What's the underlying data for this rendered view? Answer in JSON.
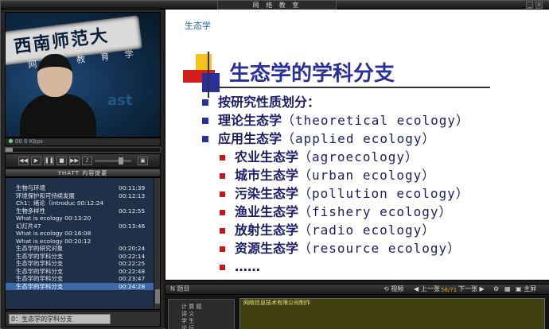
{
  "app": {
    "window_title": "网 络 教 室"
  },
  "video": {
    "banner_text": "西南师范大",
    "banner_sub": "网 络 教 育 学",
    "wall_text": "ast",
    "status": "00  0  Kbps"
  },
  "playlist": {
    "header": "YHATT  内容提要",
    "items": [
      {
        "label": "生物与环境",
        "time": "00:11:39"
      },
      {
        "label": "环境保护和可持续发展",
        "time": "00:12:13"
      },
      {
        "label": "Ch1：绪论（introduc 00:12:24",
        "time": ""
      },
      {
        "label": "生物多样性",
        "time": "00:12:55"
      },
      {
        "label": "What is ecology 00:13:20",
        "time": ""
      },
      {
        "label": "幻灯片47",
        "time": "00:13:46"
      },
      {
        "label": "What is ecology 00:16:08",
        "time": ""
      },
      {
        "label": "What is ecology 00:20:12",
        "time": ""
      },
      {
        "label": "生态学的研究对象",
        "time": "00:20:24"
      },
      {
        "label": "生态学的学科分支",
        "time": "00:22:14"
      },
      {
        "label": "生态学的学科分支",
        "time": "00:22:25"
      },
      {
        "label": "生态学的学科分支",
        "time": "00:22:48"
      },
      {
        "label": "生态学的学科分支",
        "time": "00:23:47"
      },
      {
        "label": "生态学的学科分支",
        "time": "00:24:28"
      }
    ],
    "status_field": "0：生态学的学科分支"
  },
  "slide": {
    "corner_label": "生态学",
    "title": "生态学的学科分支",
    "level1": [
      {
        "cn": "按研究性质划分：",
        "en": ""
      },
      {
        "cn": "理论生态学",
        "en": "（theoretical ecology）"
      },
      {
        "cn": "应用生态学",
        "en": "（applied ecology）"
      }
    ],
    "level2": [
      {
        "cn": "农业生态学",
        "en": "（agroecology）"
      },
      {
        "cn": "城市生态学",
        "en": "（urban ecology）"
      },
      {
        "cn": "污染生态学",
        "en": "（pollution ecology）"
      },
      {
        "cn": "渔业生态学",
        "en": "（fishery ecology）"
      },
      {
        "cn": "放射生态学",
        "en": "（radio ecology）"
      },
      {
        "cn": "资源生态学",
        "en": "（resource ecology）"
      },
      {
        "cn": "……",
        "en": ""
      }
    ]
  },
  "navigation": {
    "label": "N 题目",
    "video_label": "视频",
    "prev_label": "上一张",
    "page": "56/71",
    "next_label": "下一张",
    "home_label": "主屏"
  },
  "notes": {
    "mini_items": [
      "计 算 题",
      "讲   义",
      "学   生",
      "论   坛"
    ],
    "text": "网络信息技术有限公司制作"
  }
}
